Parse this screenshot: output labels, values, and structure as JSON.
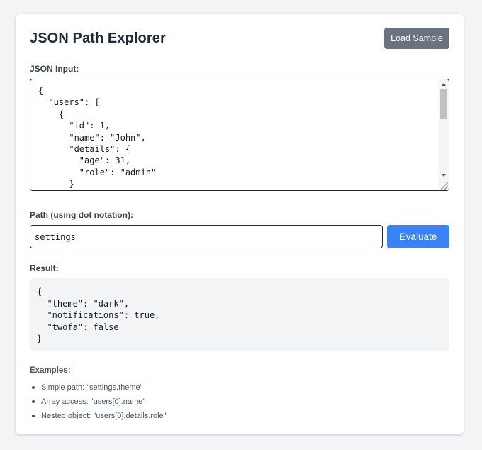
{
  "app": {
    "title": "JSON Path Explorer",
    "load_sample_label": "Load Sample"
  },
  "json_input": {
    "label": "JSON Input:",
    "value": "{\n  \"users\": [\n    {\n      \"id\": 1,\n      \"name\": \"John\",\n      \"details\": {\n        \"age\": 31,\n        \"role\": \"admin\"\n      }"
  },
  "path": {
    "label": "Path (using dot notation):",
    "value": "settings",
    "evaluate_label": "Evaluate"
  },
  "result": {
    "label": "Result:",
    "value": "{\n  \"theme\": \"dark\",\n  \"notifications\": true,\n  \"twofa\": false\n}"
  },
  "examples": {
    "label": "Examples:",
    "items": [
      "Simple path: \"settings.theme\"",
      "Array access: \"users[0].name\"",
      "Nested object: \"users[0].details.role\""
    ]
  },
  "colors": {
    "primary": "#3b82f6",
    "secondary": "#6b7280",
    "page_bg": "#f3f4f6",
    "card_bg": "#ffffff"
  },
  "icons": {
    "scroll_up": "chevron-up-icon",
    "scroll_down": "chevron-down-icon",
    "resize": "resize-grip-icon",
    "bullet": "bullet-icon"
  }
}
